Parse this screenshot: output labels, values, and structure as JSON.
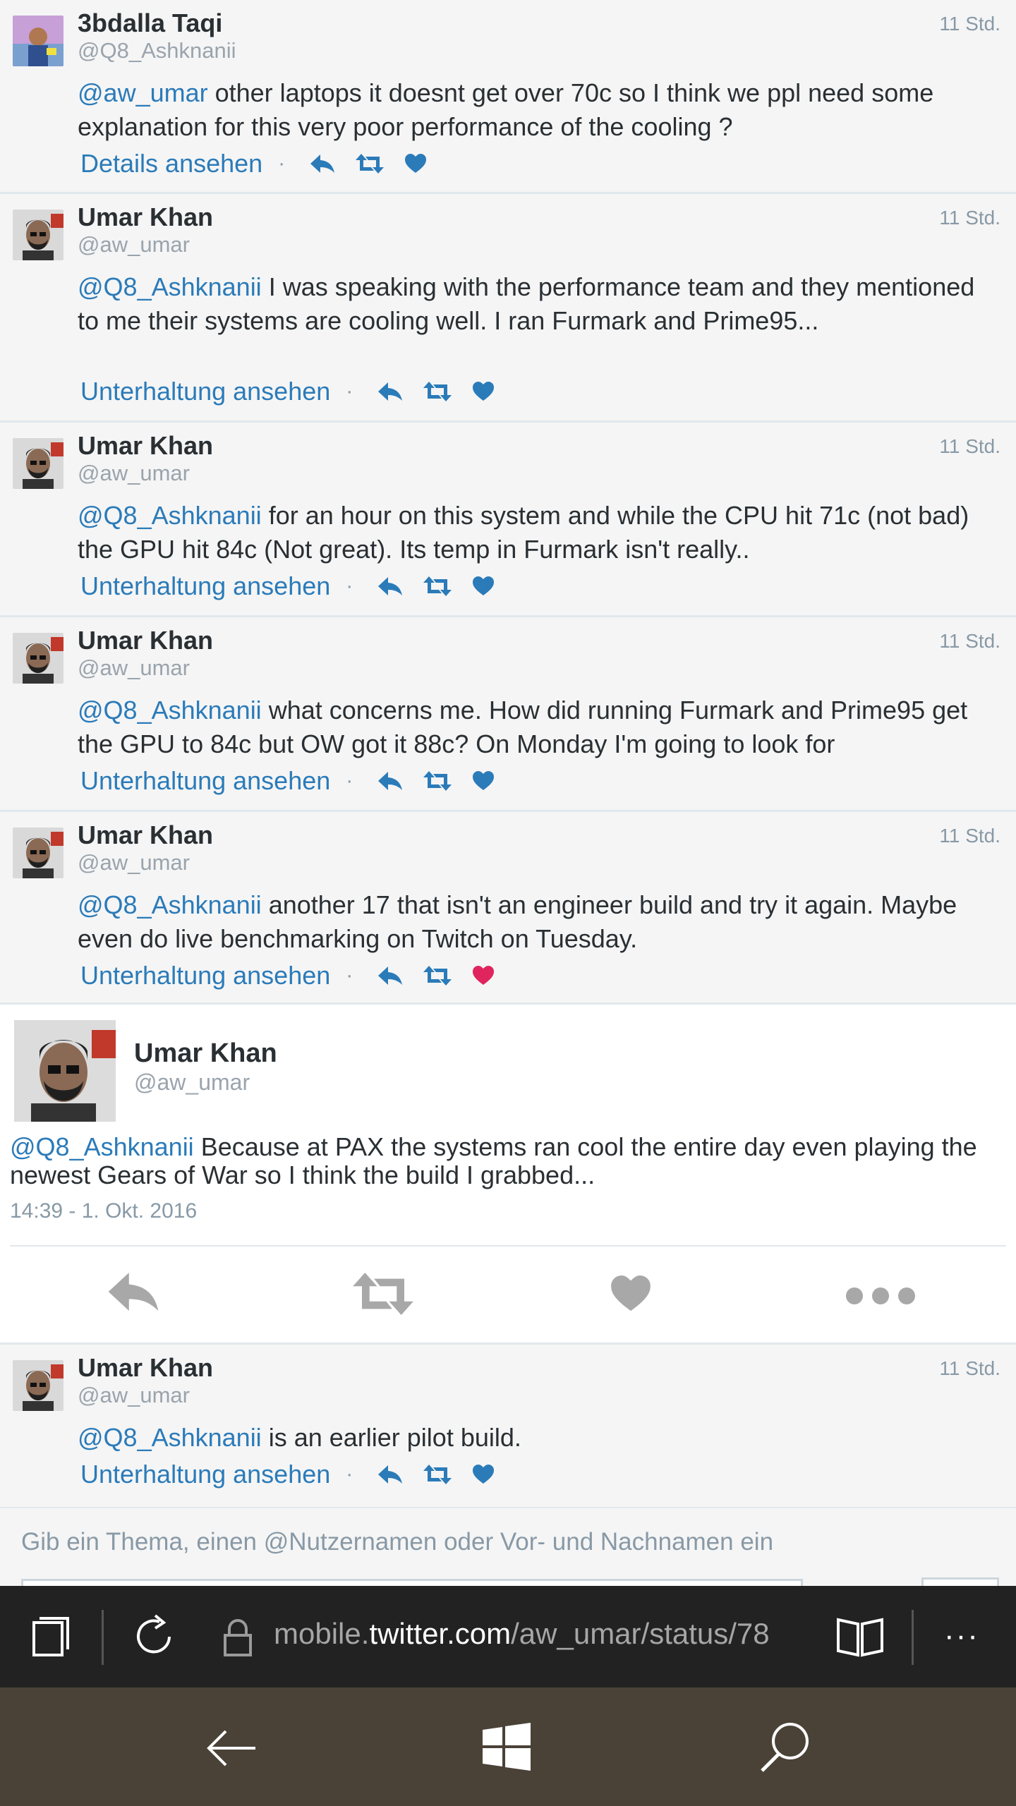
{
  "tweets_before": [
    {
      "name": "3bdalla Taqi",
      "handle": "@Q8_Ashknanii",
      "time": "11 Std.",
      "mention": "@aw_umar",
      "text": " other laptops it doesnt get over 70c so I think we ppl need some explanation for this very poor performance of the cooling ?",
      "link": "Details ansehen",
      "liked": false
    },
    {
      "name": "Umar Khan",
      "handle": "@aw_umar",
      "time": "11 Std.",
      "mention": "@Q8_Ashknanii",
      "text": " I was speaking with the performance team and they mentioned to me their systems are cooling well. I ran Furmark and Prime95...",
      "link": "Unterhaltung ansehen",
      "liked": false
    },
    {
      "name": "Umar Khan",
      "handle": "@aw_umar",
      "time": "11 Std.",
      "mention": "@Q8_Ashknanii",
      "text": " for an hour on this system and while the CPU hit 71c (not bad) the GPU hit 84c (Not great). Its temp in Furmark isn't really..",
      "link": "Unterhaltung ansehen",
      "liked": false
    },
    {
      "name": "Umar Khan",
      "handle": "@aw_umar",
      "time": "11 Std.",
      "mention": "@Q8_Ashknanii",
      "text": " what concerns me. How did running Furmark and Prime95 get the GPU to 84c but OW got it 88c? On Monday I'm going to look for",
      "link": "Unterhaltung ansehen",
      "liked": false
    },
    {
      "name": "Umar Khan",
      "handle": "@aw_umar",
      "time": "11 Std.",
      "mention": "@Q8_Ashknanii",
      "text": " another 17 that isn't an engineer build and try it again. Maybe even do live benchmarking on Twitch on Tuesday.",
      "link": "Unterhaltung ansehen",
      "liked": true
    }
  ],
  "focused_tweet": {
    "name": "Umar Khan",
    "handle": "@aw_umar",
    "mention": "@Q8_Ashknanii",
    "text": " Because at PAX the systems ran cool the entire day even playing the newest Gears of War so I think the build I grabbed...",
    "date": "14:39 - 1. Okt. 2016"
  },
  "tweet_after": {
    "name": "Umar Khan",
    "handle": "@aw_umar",
    "time": "11 Std.",
    "mention": "@Q8_Ashknanii",
    "text": " is an earlier pilot build.",
    "link": "Unterhaltung ansehen",
    "liked": false
  },
  "separator": "·",
  "search": {
    "hint": "Gib ein Thema, einen @Nutzernamen oder Vor- und Nachnamen ein"
  },
  "browser": {
    "address_prefix": "mobile.",
    "address_domain": "twitter.com",
    "address_path": "/aw_umar/status/78",
    "more_label": "···"
  },
  "colors": {
    "link": "#2b7bb9",
    "like_active": "#e0245e",
    "browser_bar": "#222222",
    "nav_bar": "#4a4237"
  }
}
